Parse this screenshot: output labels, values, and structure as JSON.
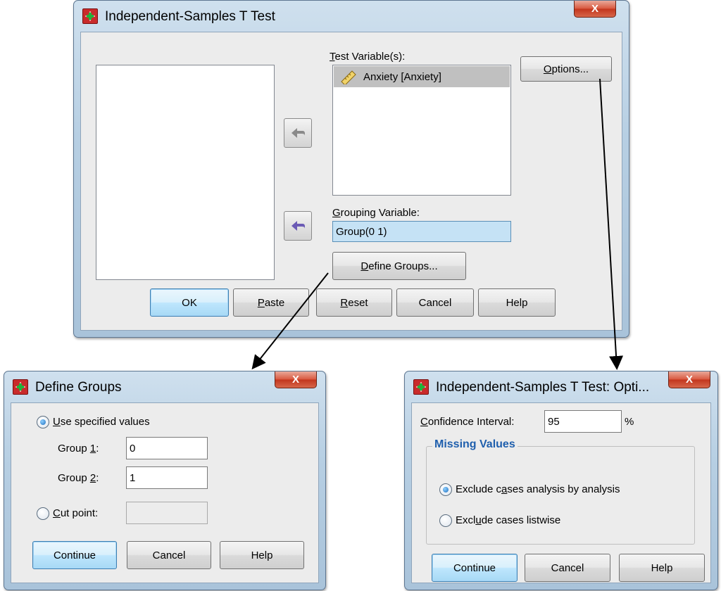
{
  "main_dialog": {
    "title": "Independent-Samples T Test",
    "close_label": "X",
    "test_variables_label": "Test Variable(s):",
    "test_variables": [
      {
        "name": "Anxiety [Anxiety]",
        "icon": "scale-ruler-icon"
      }
    ],
    "grouping_variable_label": "Grouping Variable:",
    "grouping_variable_value": "Group(0 1)",
    "options_button": "Options...",
    "define_groups_button": "Define Groups...",
    "buttons": {
      "ok": "OK",
      "paste": "Paste",
      "reset": "Reset",
      "cancel": "Cancel",
      "help": "Help"
    }
  },
  "define_groups_dialog": {
    "title": "Define Groups",
    "close_label": "X",
    "use_specified_label": "Use specified values",
    "group1_label": "Group 1:",
    "group1_value": "0",
    "group2_label": "Group 2:",
    "group2_value": "1",
    "cut_point_label": "Cut point:",
    "cut_point_value": "",
    "selected_option": "use_specified_values",
    "buttons": {
      "continue": "Continue",
      "cancel": "Cancel",
      "help": "Help"
    }
  },
  "options_dialog": {
    "title": "Independent-Samples T Test: Opti...",
    "close_label": "X",
    "confidence_interval_label": "Confidence Interval:",
    "confidence_interval_value": "95",
    "percent_sign": "%",
    "missing_values_title": "Missing Values",
    "exclude_analysis_label": "Exclude cases analysis by analysis",
    "exclude_listwise_label": "Exclude cases listwise",
    "selected_option": "exclude_cases_analysis_by_analysis",
    "buttons": {
      "continue": "Continue",
      "cancel": "Cancel",
      "help": "Help"
    }
  },
  "colors": {
    "window_frame": "#b7cfe3",
    "client_background": "#ececec",
    "selected_item": "#c0c0c0",
    "grouping_highlight": "#c5e2f5",
    "close_button": "#c2351d",
    "group_title": "#1f5fad",
    "arrow_active": "#6b5bb5",
    "arrow_inactive": "#8a8a8a"
  }
}
